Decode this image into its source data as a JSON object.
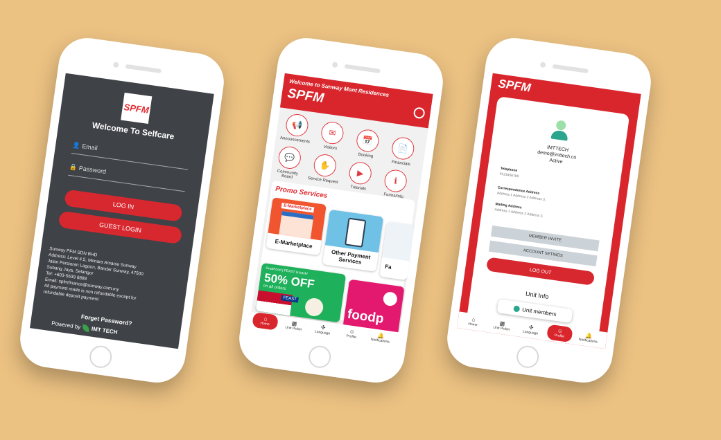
{
  "colors": {
    "background": "#ecc283",
    "brand_red": "#d9262d",
    "dark_bg": "#3f4247"
  },
  "login_screen": {
    "logo": "SPFM",
    "title": "Welcome To Selfcare",
    "email_placeholder": "Email",
    "password_placeholder": "Password",
    "login_label": "LOG IN",
    "guest_label": "GUEST LOGIN",
    "address_lines": [
      "Sunway PFM SDN BHD",
      "Address: Level 4.5, Menara Amanie Sunway",
      "Jalan Persiaran Lagoon, Bandar Sunway, 47500",
      "Subang Jaya, Selangor",
      "Tel: +603-5639 8888",
      "Email: spfmfinance@sunway.com.my",
      "All payment made is non refundable except for",
      "refundable deposit payment"
    ],
    "forgot_label": "Forget Password?",
    "powered_label": "Powered by",
    "powered_brand": "IMT TECH"
  },
  "home_screen": {
    "welcome": "Welcome to Sunway Mont Residences",
    "logo": "SPFM",
    "services": [
      {
        "label": "Announcements",
        "icon": "megaphone-icon",
        "glyph": "📢"
      },
      {
        "label": "Visitors",
        "icon": "visitors-icon",
        "glyph": "✉"
      },
      {
        "label": "Booking",
        "icon": "calendar-icon",
        "glyph": "📅"
      },
      {
        "label": "Financials",
        "icon": "document-icon",
        "glyph": "📄"
      },
      {
        "label": "Community Board",
        "icon": "chat-icon",
        "glyph": "💬"
      },
      {
        "label": "Service Request",
        "icon": "hand-icon",
        "glyph": "✋"
      },
      {
        "label": "Tutorials",
        "icon": "video-icon",
        "glyph": "▶"
      },
      {
        "label": "Forms/Info",
        "icon": "info-icon",
        "glyph": "ℹ"
      }
    ],
    "promo_title": "Promo Services",
    "promo_cards": [
      {
        "label": "E-Marketplace",
        "badge": "E-Marketplace"
      },
      {
        "label": "Other Payment Services"
      },
      {
        "label": "Fa"
      }
    ],
    "grabfood": {
      "brand": "GrabFood",
      "feast": "FEAST is back!",
      "headline": "50% OFF",
      "sub": "on all orders",
      "tag": "FEAST"
    },
    "foodpanda": "foodp",
    "nav": [
      {
        "label": "Home",
        "glyph": "⌂"
      },
      {
        "label": "Unit Picker",
        "glyph": "▦"
      },
      {
        "label": "Language",
        "glyph": "✣"
      },
      {
        "label": "Profile",
        "glyph": "☺"
      },
      {
        "label": "Notifications",
        "glyph": "🔔"
      }
    ]
  },
  "profile_screen": {
    "logo": "SPFM",
    "name": "IMTTECH",
    "email": "demo@imttech.co",
    "status": "Active",
    "telephone_label": "Telephone",
    "telephone": "0123456789",
    "corr_label": "Correspondence Address",
    "corr_value": "Address 1 Address 2 Address 3,",
    "mail_label": "Mailing Address",
    "mail_value": "Address 1 Address 2 Address 3,",
    "member_invite": "MEMBER INVITE",
    "account_settings": "ACCOUNT SETINGS",
    "logout": "LOG OUT",
    "unit_info": "Unit Info",
    "unit_members": "Unit members",
    "nav": [
      {
        "label": "Home",
        "glyph": "⌂"
      },
      {
        "label": "Unit Picker",
        "glyph": "▦"
      },
      {
        "label": "Language",
        "glyph": "✣"
      },
      {
        "label": "Profile",
        "glyph": "☺"
      },
      {
        "label": "Notifications",
        "glyph": "🔔"
      }
    ]
  }
}
